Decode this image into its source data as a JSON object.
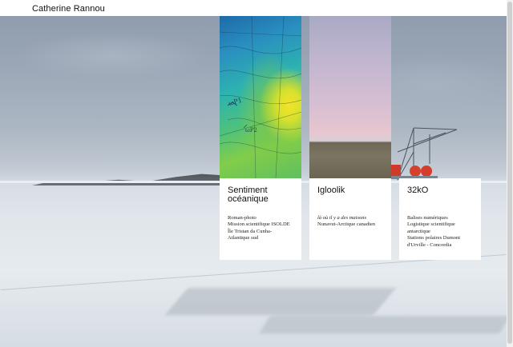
{
  "header": {
    "site_title": "Catherine Rannou"
  },
  "projects": [
    {
      "title_lines": [
        "Sentiment",
        "océanique"
      ],
      "lines": [
        "Roman-photo",
        "Mission scientifique ISOLDE",
        "Île Tristan da Cunha-",
        "Atlantique sud"
      ],
      "image": "ocean-map-thumbnail"
    },
    {
      "title_lines": [
        "Igloolik"
      ],
      "lines_italic": [
        "là où il y a des maisons"
      ],
      "lines": [
        "Nunavut-Arctique canadien"
      ],
      "image": "arctic-landscape-thumbnail"
    },
    {
      "title_lines": [
        "32kO"
      ],
      "lines": [
        "Balises numériques",
        "Logistique scientifique",
        "antarctique",
        "Stations polaires Dumont",
        "d'Urville - Concordia"
      ],
      "image": null
    }
  ],
  "background": {
    "image": "antarctic-ice-field-photo"
  },
  "colors": {
    "header_bg": "#ffffff",
    "card_bg": "#ffffff",
    "text": "#111111"
  }
}
